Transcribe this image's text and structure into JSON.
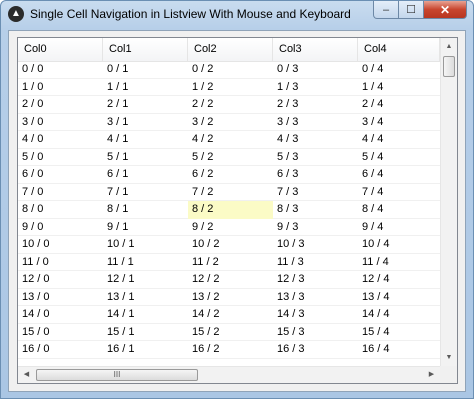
{
  "window": {
    "title": "Single Cell Navigation in Listview With Mouse and Keyboard",
    "icon": "app-logo-icon",
    "buttons": {
      "minimize": "–",
      "maximize": "☐",
      "close": "✕"
    }
  },
  "listview": {
    "columns": [
      "Col0",
      "Col1",
      "Col2",
      "Col3",
      "Col4"
    ],
    "rows": [
      [
        "0 / 0",
        "0 / 1",
        "0 / 2",
        "0 / 3",
        "0 / 4"
      ],
      [
        "1 / 0",
        "1 / 1",
        "1 / 2",
        "1 / 3",
        "1 / 4"
      ],
      [
        "2 / 0",
        "2 / 1",
        "2 / 2",
        "2 / 3",
        "2 / 4"
      ],
      [
        "3 / 0",
        "3 / 1",
        "3 / 2",
        "3 / 3",
        "3 / 4"
      ],
      [
        "4 / 0",
        "4 / 1",
        "4 / 2",
        "4 / 3",
        "4 / 4"
      ],
      [
        "5 / 0",
        "5 / 1",
        "5 / 2",
        "5 / 3",
        "5 / 4"
      ],
      [
        "6 / 0",
        "6 / 1",
        "6 / 2",
        "6 / 3",
        "6 / 4"
      ],
      [
        "7 / 0",
        "7 / 1",
        "7 / 2",
        "7 / 3",
        "7 / 4"
      ],
      [
        "8 / 0",
        "8 / 1",
        "8 / 2",
        "8 / 3",
        "8 / 4"
      ],
      [
        "9 / 0",
        "9 / 1",
        "9 / 2",
        "9 / 3",
        "9 / 4"
      ],
      [
        "10 / 0",
        "10 / 1",
        "10 / 2",
        "10 / 3",
        "10 / 4"
      ],
      [
        "11 / 0",
        "11 / 1",
        "11 / 2",
        "11 / 3",
        "11 / 4"
      ],
      [
        "12 / 0",
        "12 / 1",
        "12 / 2",
        "12 / 3",
        "12 / 4"
      ],
      [
        "13 / 0",
        "13 / 1",
        "13 / 2",
        "13 / 3",
        "13 / 4"
      ],
      [
        "14 / 0",
        "14 / 1",
        "14 / 2",
        "14 / 3",
        "14 / 4"
      ],
      [
        "15 / 0",
        "15 / 1",
        "15 / 2",
        "15 / 3",
        "15 / 4"
      ],
      [
        "16 / 0",
        "16 / 1",
        "16 / 2",
        "16 / 3",
        "16 / 4"
      ]
    ],
    "selected_cell": {
      "row": 8,
      "col": 2
    },
    "selection_color": "#fbfbc6"
  },
  "scrollbars": {
    "up_arrow": "▲",
    "down_arrow": "▼",
    "left_arrow": "◀",
    "right_arrow": "▶",
    "hthumb_grip": "III"
  }
}
